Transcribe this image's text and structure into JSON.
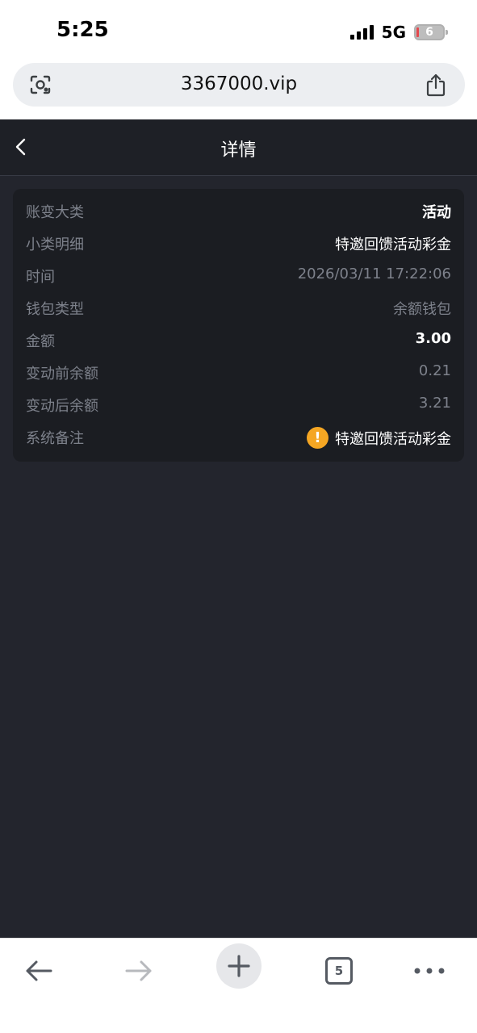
{
  "status_bar": {
    "time": "5:25",
    "network": "5G",
    "battery": "6"
  },
  "url_bar": {
    "url": "3367000.vip"
  },
  "header": {
    "title": "详情"
  },
  "details": [
    {
      "label": "账变大类",
      "value": "活动",
      "style": "bold"
    },
    {
      "label": "小类明细",
      "value": "特邀回馈活动彩金",
      "style": "normal"
    },
    {
      "label": "时间",
      "value": "2026/03/11 17:22:06",
      "style": "dim"
    },
    {
      "label": "钱包类型",
      "value": "余额钱包",
      "style": "dim"
    },
    {
      "label": "金额",
      "value": "3.00",
      "style": "bold"
    },
    {
      "label": "变动前余额",
      "value": "0.21",
      "style": "dim"
    },
    {
      "label": "变动后余额",
      "value": "3.21",
      "style": "dim"
    },
    {
      "label": "系统备注",
      "value": "特邀回馈活动彩金",
      "style": "normal",
      "icon": "warning-icon",
      "icon_glyph": "!"
    }
  ],
  "toolbar": {
    "tab_count": "5"
  },
  "colors": {
    "page_bg": "#23252d",
    "card_bg": "#1b1d22",
    "label": "#7d818b",
    "warning": "#f5a623"
  }
}
